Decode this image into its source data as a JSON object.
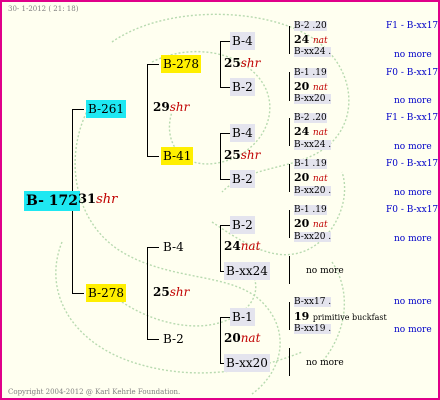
{
  "header": {
    "date": "30- 1-2012 ( 21: 18)"
  },
  "footer": {
    "copyright": "Copyright 2004-2012 @ Karl Kehrle Foundation."
  },
  "root": {
    "label": "B- 172",
    "year": "31",
    "suffix": "shr"
  },
  "gen1": [
    {
      "label": "B-261",
      "year": "29",
      "suffix": "shr"
    },
    {
      "label": "B-278",
      "year": "25",
      "suffix": "shr"
    }
  ],
  "gen2": [
    {
      "label": "B-278",
      "year": "25",
      "suffix": "shr"
    },
    {
      "label": "B-41",
      "year": "25",
      "suffix": "shr"
    },
    {
      "label": "B-4",
      "year": "24",
      "suffix": "nat"
    },
    {
      "label": "B-2",
      "year": "20",
      "suffix": "nat"
    }
  ],
  "gen3": [
    {
      "label": "B-4"
    },
    {
      "label": "B-2"
    },
    {
      "label": "B-4"
    },
    {
      "label": "B-2"
    },
    {
      "label": "B-2"
    },
    {
      "label": "B-xx24"
    },
    {
      "label": "B-1"
    },
    {
      "label": "B-xx20"
    }
  ],
  "gen4": [
    {
      "top": "B-2 .20",
      "year": "24",
      "suffix": "nat",
      "bottom": "B-xx24 .",
      "right_top": "F1 - B-xx17",
      "more": "no more"
    },
    {
      "top": "B-1 .19",
      "year": "20",
      "suffix": "nat",
      "bottom": "B-xx20 .",
      "right_top": "F0 - B-xx17",
      "more": "no more"
    },
    {
      "top": "B-2 .20",
      "year": "24",
      "suffix": "nat",
      "bottom": "B-xx24 .",
      "right_top": "F1 - B-xx17",
      "more": "no more"
    },
    {
      "top": "B-1 .19",
      "year": "20",
      "suffix": "nat",
      "bottom": "B-xx20 .",
      "right_top": "F0 - B-xx17",
      "more": "no more"
    },
    {
      "top": "B-1 .19",
      "year": "20",
      "suffix": "nat",
      "bottom": "B-xx20 .",
      "right_top": "F0 - B-xx17",
      "more": "no more"
    },
    {
      "no_more": "no more"
    },
    {
      "top": "B-xx17 .",
      "year": "19",
      "suffix": "primitive buckfast",
      "bottom": "B-xx19 .",
      "more_top": "no more",
      "more": "no more"
    },
    {
      "no_more": "no more"
    }
  ]
}
